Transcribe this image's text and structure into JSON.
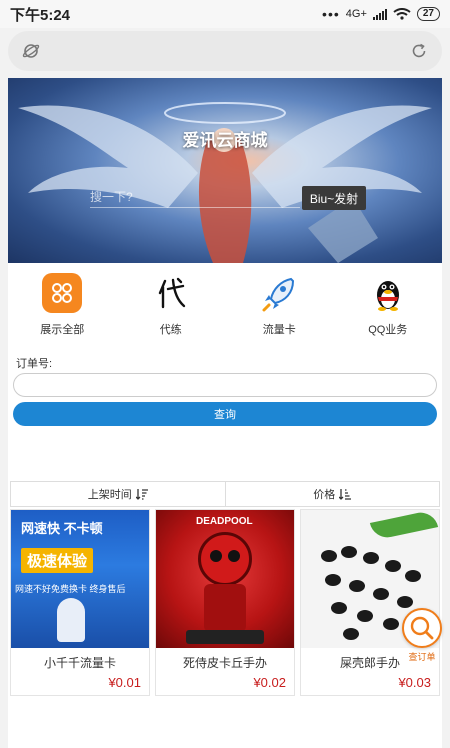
{
  "status_bar": {
    "time": "下午5:24",
    "network": "4G+",
    "battery": "27"
  },
  "browser": {
    "url_placeholder": ""
  },
  "banner": {
    "title": "爱讯云商城",
    "search_placeholder": "搜一下?",
    "search_button": "Biu~发射"
  },
  "quick_nav": [
    {
      "label": "展示全部",
      "icon": "grid-icon"
    },
    {
      "label": "代练",
      "icon": "dai-character-icon"
    },
    {
      "label": "流量卡",
      "icon": "rocket-icon"
    },
    {
      "label": "QQ业务",
      "icon": "qq-penguin-icon"
    }
  ],
  "order_query": {
    "label": "订单号:",
    "input_value": "",
    "button": "查询"
  },
  "sort": {
    "by_time": "上架时间",
    "by_price": "价格"
  },
  "products": [
    {
      "name": "小千千流量卡",
      "price": "¥0.01",
      "image_text": [
        "网速快 不卡顿",
        "极速体验",
        "网速不好免费换卡 终身售后"
      ]
    },
    {
      "name": "死侍皮卡丘手办",
      "price": "¥0.02",
      "image_text": [
        "DEADPOOL"
      ]
    },
    {
      "name": "屎壳郎手办",
      "price": "¥0.03",
      "image_text": []
    }
  ],
  "floating_button": {
    "label": "查订单"
  },
  "colors": {
    "accent_blue": "#1d86d3",
    "price_red": "#c81e1e",
    "fab_orange": "#f07d1a",
    "nav_orange": "#f5871f"
  }
}
